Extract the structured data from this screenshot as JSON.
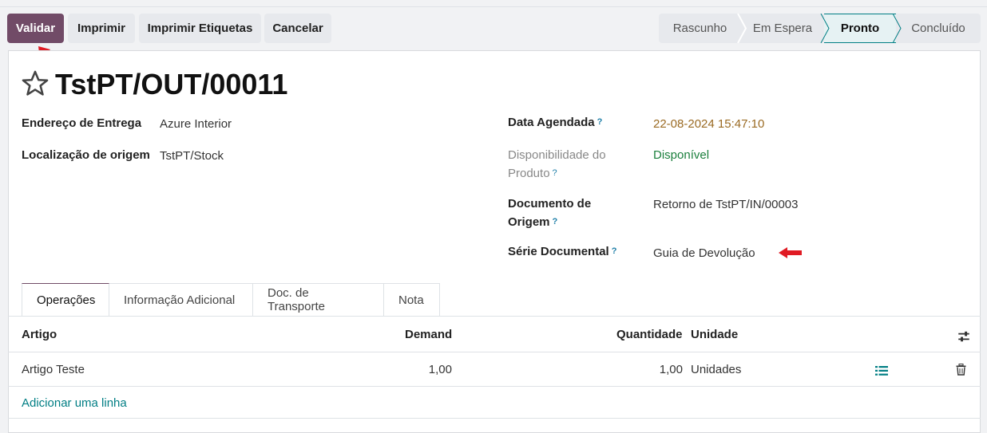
{
  "toolbar": {
    "validate": "Validar",
    "print": "Imprimir",
    "print_labels": "Imprimir Etiquetas",
    "cancel": "Cancelar"
  },
  "status": {
    "stages": [
      "Rascunho",
      "Em Espera",
      "Pronto",
      "Concluído"
    ],
    "active": "Pronto"
  },
  "record": {
    "title": "TstPT/OUT/00011",
    "delivery_address_label": "Endereço de Entrega",
    "delivery_address_value": "Azure Interior",
    "source_location_label": "Localização de origem",
    "source_location_value": "TstPT/Stock",
    "scheduled_date_label": "Data Agendada",
    "scheduled_date_value": "22-08-2024 15:47:10",
    "availability_label_1": "Disponibilidade do",
    "availability_label_2": "Produto",
    "availability_value": "Disponível",
    "origin_doc_label_1": "Documento de",
    "origin_doc_label_2": "Origem",
    "origin_doc_value": "Retorno de TstPT/IN/00003",
    "doc_series_label": "Série Documental",
    "doc_series_value": "Guia de Devolução",
    "help_mark": "?"
  },
  "tabs": [
    "Operações",
    "Informação Adicional",
    "Doc. de Transporte",
    "Nota"
  ],
  "table": {
    "headers": {
      "product": "Artigo",
      "demand": "Demand",
      "quantity": "Quantidade",
      "unit": "Unidade"
    },
    "rows": [
      {
        "product": "Artigo Teste",
        "demand": "1,00",
        "quantity": "1,00",
        "unit": "Unidades"
      }
    ],
    "add_line": "Adicionar uma linha"
  },
  "colors": {
    "primary": "#714b67",
    "teal": "#017e84",
    "date": "#9a6a22",
    "available": "#1a7f3c",
    "arrow": "#e01b24"
  }
}
